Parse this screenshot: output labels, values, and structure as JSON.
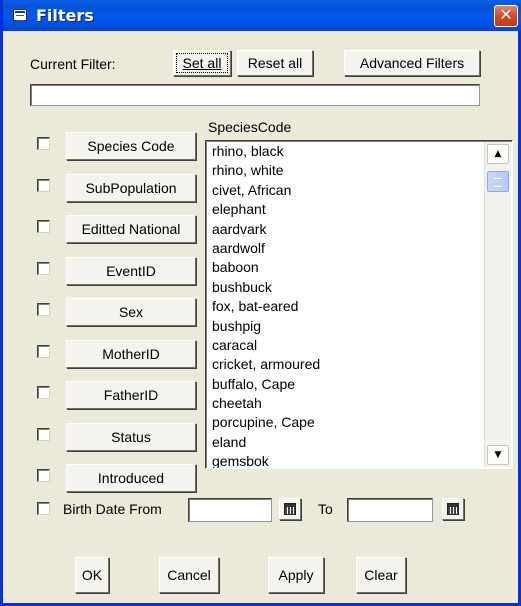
{
  "window": {
    "title": "Filters",
    "close_symbol": "✕"
  },
  "toolbar": {
    "current_filter_label": "Current Filter:",
    "set_all": "Set all",
    "reset_all": "Reset all",
    "advanced_filters": "Advanced Filters"
  },
  "current_filter_value": "",
  "filters": [
    {
      "label": "Species Code",
      "checked": false
    },
    {
      "label": "SubPopulation",
      "checked": false
    },
    {
      "label": "Editted National",
      "checked": false
    },
    {
      "label": "EventID",
      "checked": false
    },
    {
      "label": "Sex",
      "checked": false
    },
    {
      "label": "MotherID",
      "checked": false
    },
    {
      "label": "FatherID",
      "checked": false
    },
    {
      "label": "Status",
      "checked": false
    },
    {
      "label": "Introduced",
      "checked": false
    }
  ],
  "list": {
    "header": "SpeciesCode",
    "items": [
      "rhino, black",
      "rhino, white",
      "civet, African",
      "elephant",
      "aardvark",
      "aardwolf",
      "baboon",
      "bushbuck",
      "fox, bat-eared",
      "bushpig",
      "caracal",
      "cricket, armoured",
      "buffalo, Cape",
      "cheetah",
      "porcupine, Cape",
      "eland",
      "gemsbok"
    ]
  },
  "birth_date": {
    "from_label": "Birth Date From",
    "to_label": "To",
    "from_value": "",
    "to_value": ""
  },
  "actions": {
    "ok": "OK",
    "cancel": "Cancel",
    "apply": "Apply",
    "clear": "Clear"
  },
  "icons": {
    "window": "form-icon",
    "close": "close-icon",
    "scroll_up": "scroll-up-arrow-icon",
    "scroll_down": "scroll-down-arrow-icon",
    "calendar": "calendar-icon"
  },
  "colors": {
    "title_bar": "#0058ee",
    "dialog_bg": "#ece9d8",
    "close_button": "#d24a25"
  }
}
